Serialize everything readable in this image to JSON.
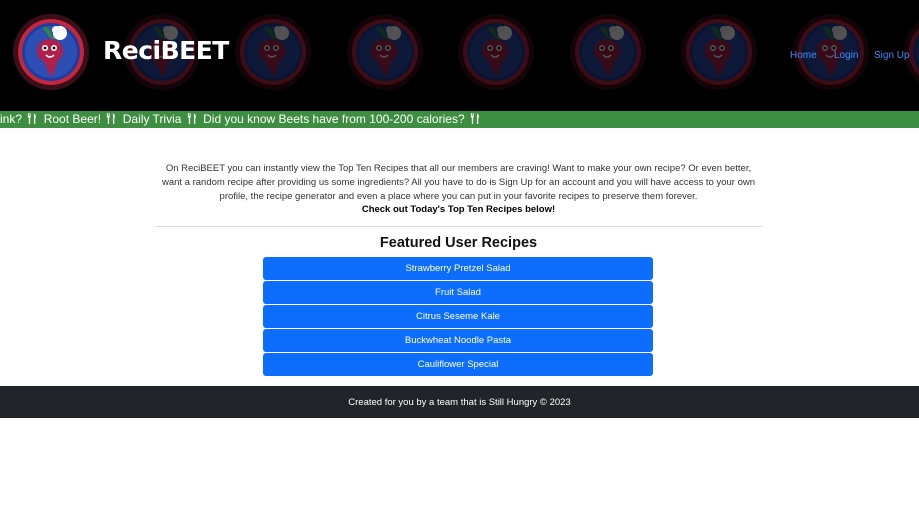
{
  "header": {
    "brand": "ReciBEET",
    "nav": [
      {
        "label": "Home"
      },
      {
        "label": "Login"
      },
      {
        "label": "Sign Up"
      }
    ]
  },
  "ticker": {
    "items": [
      "rink?",
      "Root Beer!",
      "Daily Trivia",
      "Did you know Beets have from 100-200 calories?"
    ]
  },
  "intro": {
    "text": "On ReciBEET you can instantly view the Top Ten Recipes that all our members are craving! Want to make your own recipe? Or even better, want a random recipe after providing us some ingredients? All you have to do is Sign Up for an account and you will have access to your own profile, the recipe generator and even a place where you can put in your favorite recipes to preserve them forever.",
    "cta": "Check out Today's Top Ten Recipes below!"
  },
  "featured": {
    "title": "Featured User Recipes",
    "recipes": [
      "Strawberry Pretzel Salad",
      "Fruit Salad",
      "Citrus Seseme Kale",
      "Buckwheat Noodle Pasta",
      "Cauliflower Special"
    ]
  },
  "footer": {
    "text": "Created for you by a team that is Still Hungry © 2023"
  },
  "colors": {
    "header_bg": "#000000",
    "ticker_bg": "#3e8e41",
    "button": "#0d6efd",
    "nav_link": "#3d8bfd",
    "footer_bg": "#212529"
  },
  "icons": [
    "beet-chef-logo",
    "fork-knife-icon"
  ]
}
